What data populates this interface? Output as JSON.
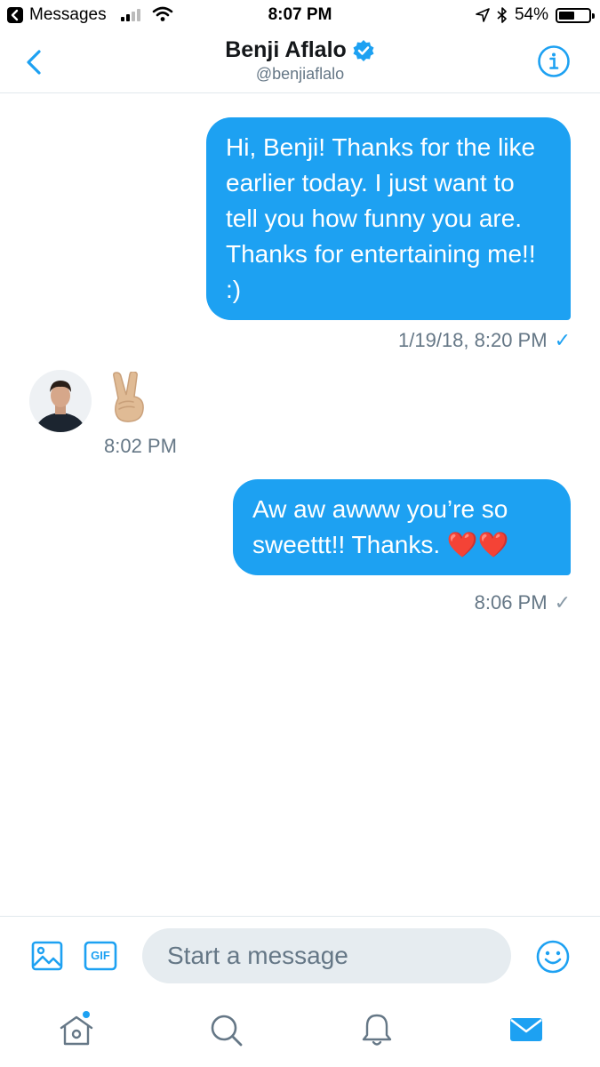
{
  "status_bar": {
    "back_app": "Messages",
    "time": "8:07 PM",
    "battery": "54%",
    "battery_level": 0.54
  },
  "header": {
    "name": "Benji Aflalo",
    "handle": "@benjiaflalo"
  },
  "messages": [
    {
      "direction": "outgoing",
      "text": "Hi, Benji! Thanks for the like earlier today. I just want to tell you how funny you are. Thanks for entertaining me!! :)",
      "timestamp": "1/19/18, 8:20 PM",
      "check": "✓",
      "seen": true
    },
    {
      "direction": "incoming",
      "content": "victory-hand-emoji",
      "timestamp": "8:02 PM"
    },
    {
      "direction": "outgoing",
      "text": "Aw aw awww you’re so sweettt!! Thanks.",
      "emoji": "❤️❤️",
      "timestamp": "8:06 PM",
      "check": "✓",
      "seen": false
    }
  ],
  "composer": {
    "placeholder": "Start a message",
    "gif_label": "GIF"
  },
  "colors": {
    "accent": "#1da1f2",
    "secondary_text": "#657786",
    "divider": "#e1e8ed",
    "input_bg": "#e6ecf0",
    "heart": "#e0245e"
  }
}
